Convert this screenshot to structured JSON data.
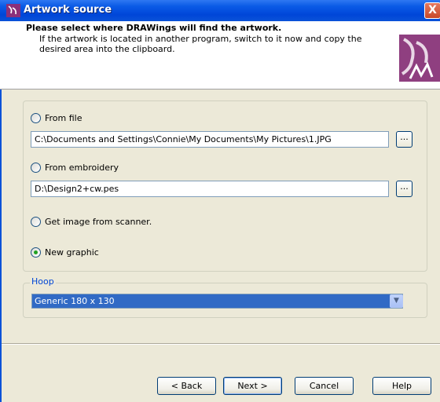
{
  "window": {
    "title": "Artwork source",
    "close_glyph": "X"
  },
  "header": {
    "title": "Please select where DRAWings will find the artwork.",
    "description": "If the artwork is located in another program, switch to it now and copy the desired area into the clipboard."
  },
  "sources": {
    "from_file": {
      "label": "From file",
      "path": "C:\\Documents and Settings\\Connie\\My Documents\\My Pictures\\1.JPG",
      "browse_label": "...",
      "selected": false
    },
    "from_embroidery": {
      "label": "From embroidery",
      "path": "D:\\Design2+cw.pes",
      "browse_label": "...",
      "selected": false
    },
    "scanner": {
      "label": "Get image from scanner.",
      "selected": false
    },
    "new_graphic": {
      "label": "New graphic",
      "selected": true
    }
  },
  "hoop": {
    "label": "Hoop",
    "selected": "Generic 180 x 130"
  },
  "buttons": {
    "back": "< Back",
    "next": "Next >",
    "cancel": "Cancel",
    "help": "Help"
  },
  "icons": {
    "title": "drawings-app-icon",
    "logo": "drawings-logo-icon"
  }
}
